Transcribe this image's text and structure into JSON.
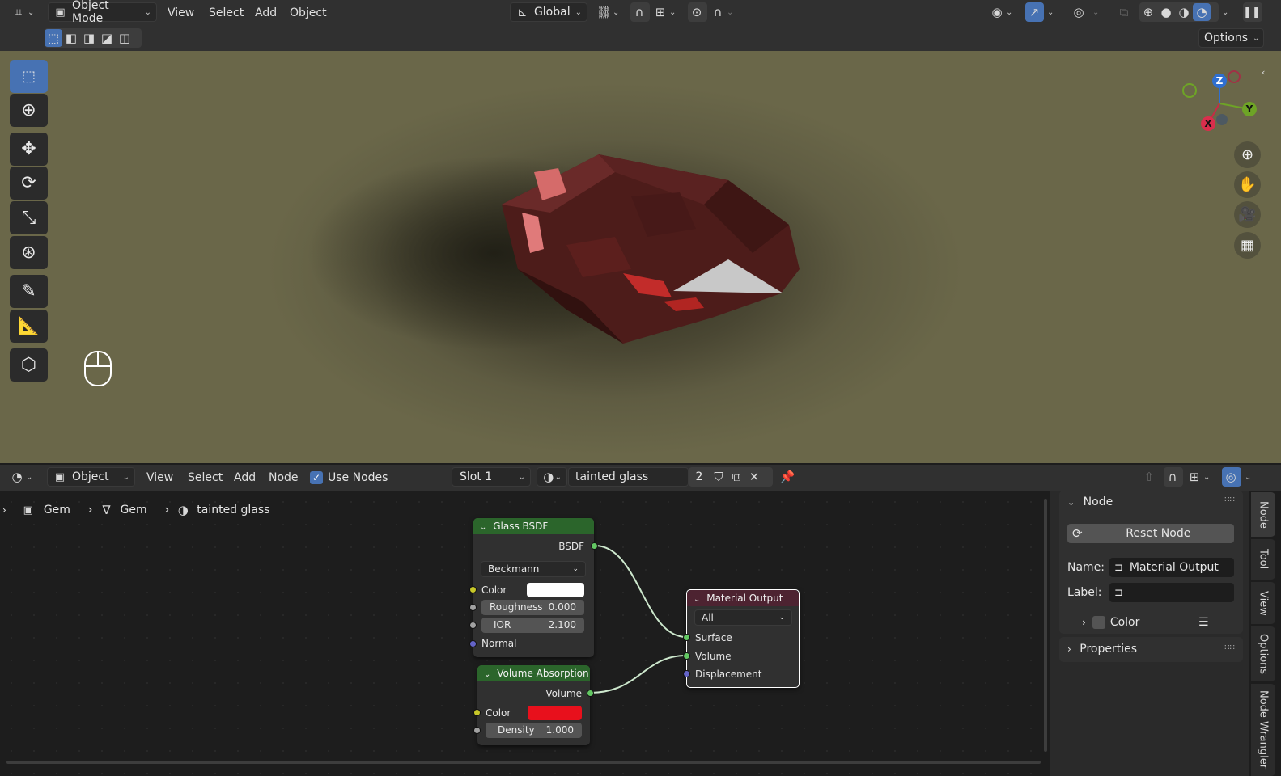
{
  "viewport_header": {
    "editor_type_icon": "editor-type-icon",
    "mode_label": "Object Mode",
    "menus": [
      "View",
      "Select",
      "Add",
      "Object"
    ],
    "orientation_label": "Global",
    "options_label": "Options"
  },
  "viewport": {
    "gizmo": {
      "z": "Z",
      "y": "Y",
      "x": "X"
    },
    "nav_icons": [
      "zoom-icon",
      "hand-pan-icon",
      "camera-icon",
      "perspective-grid-icon"
    ],
    "tools": [
      "select-box-tool",
      "cursor-tool",
      "move-tool",
      "rotate-tool",
      "scale-tool",
      "transform-tool",
      "annotate-tool",
      "measure-tool",
      "add-cube-tool"
    ]
  },
  "node_header": {
    "object_label": "Object",
    "menus": [
      "View",
      "Select",
      "Add",
      "Node"
    ],
    "use_nodes_label": "Use Nodes",
    "use_nodes_checked": true,
    "slot_label": "Slot 1",
    "material_name": "tainted glass",
    "user_count": "2"
  },
  "breadcrumb": {
    "object": "Gem",
    "mesh": "Gem",
    "material": "tainted glass"
  },
  "nodes": {
    "glass_bsdf": {
      "title": "Glass BSDF",
      "output": "BSDF",
      "distribution": "Beckmann",
      "color_label": "Color",
      "color_value": "#ffffff",
      "roughness_label": "Roughness",
      "roughness_value": "0.000",
      "ior_label": "IOR",
      "ior_value": "2.100",
      "normal_label": "Normal"
    },
    "volume_absorption": {
      "title": "Volume Absorption",
      "output": "Volume",
      "color_label": "Color",
      "color_value": "#e8101c",
      "density_label": "Density",
      "density_value": "1.000"
    },
    "material_output": {
      "title": "Material Output",
      "target": "All",
      "surface_label": "Surface",
      "volume_label": "Volume",
      "displacement_label": "Displacement"
    }
  },
  "sidebar": {
    "node_panel_title": "Node",
    "reset_node_label": "Reset Node",
    "name_label": "Name:",
    "name_value": "Material Output",
    "label_label": "Label:",
    "label_value": "",
    "color_label": "Color",
    "properties_label": "Properties",
    "tabs": [
      "Node",
      "Tool",
      "View",
      "Options",
      "Node Wrangler"
    ]
  },
  "colors": {
    "accent": "#4772b3",
    "shader_node_header": "#2b652b",
    "output_node_header": "#4d2331",
    "shader_socket": "#63c763",
    "color_socket": "#c7c729",
    "float_socket": "#a1a1a1",
    "vector_socket": "#6363c7"
  }
}
